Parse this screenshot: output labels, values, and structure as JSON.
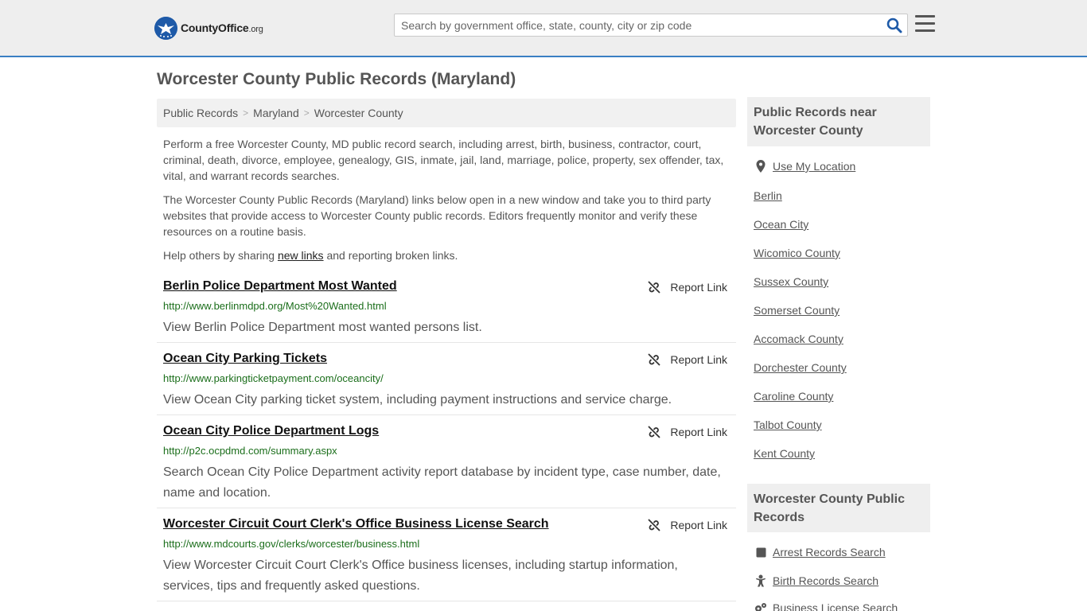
{
  "header": {
    "logo_text": "CountyOffice",
    "logo_suffix": ".org",
    "search_placeholder": "Search by government office, state, county, city or zip code"
  },
  "page": {
    "title": "Worcester County Public Records (Maryland)"
  },
  "breadcrumb": [
    "Public Records",
    "Maryland",
    "Worcester County"
  ],
  "intro": {
    "p1": "Perform a free Worcester County, MD public record search, including arrest, birth, business, contractor, court, criminal, death, divorce, employee, genealogy, GIS, inmate, jail, land, marriage, police, property, sex offender, tax, vital, and warrant records searches.",
    "p2": "The Worcester County Public Records (Maryland) links below open in a new window and take you to third party websites that provide access to Worcester County public records. Editors frequently monitor and verify these resources on a routine basis.",
    "p3_before": "Help others by sharing ",
    "p3_link": "new links",
    "p3_after": " and reporting broken links."
  },
  "report_label": "Report Link",
  "records": [
    {
      "title": "Berlin Police Department Most Wanted",
      "url": "http://www.berlinmdpd.org/Most%20Wanted.html",
      "desc": "View Berlin Police Department most wanted persons list."
    },
    {
      "title": "Ocean City Parking Tickets",
      "url": "http://www.parkingticketpayment.com/oceancity/",
      "desc": "View Ocean City parking ticket system, including payment instructions and service charge."
    },
    {
      "title": "Ocean City Police Department Logs",
      "url": "http://p2c.ocpdmd.com/summary.aspx",
      "desc": "Search Ocean City Police Department activity report database by incident type, case number, date, name and location."
    },
    {
      "title": "Worcester Circuit Court Clerk's Office Business License Search",
      "url": "http://www.mdcourts.gov/clerks/worcester/business.html",
      "desc": "View Worcester Circuit Court Clerk's Office business licenses, including startup information, services, tips and frequently asked questions."
    }
  ],
  "sidebar": {
    "nearby_heading": "Public Records near Worcester County",
    "use_location": "Use My Location",
    "nearby": [
      "Berlin",
      "Ocean City",
      "Wicomico County",
      "Sussex County",
      "Somerset County",
      "Accomack County",
      "Dorchester County",
      "Caroline County",
      "Talbot County",
      "Kent County"
    ],
    "records_heading": "Worcester County Public Records",
    "record_links": [
      {
        "label": "Arrest Records Search",
        "icon": "square-icon"
      },
      {
        "label": "Birth Records Search",
        "icon": "baby-icon"
      },
      {
        "label": "Business License Search",
        "icon": "gears-icon"
      }
    ]
  }
}
